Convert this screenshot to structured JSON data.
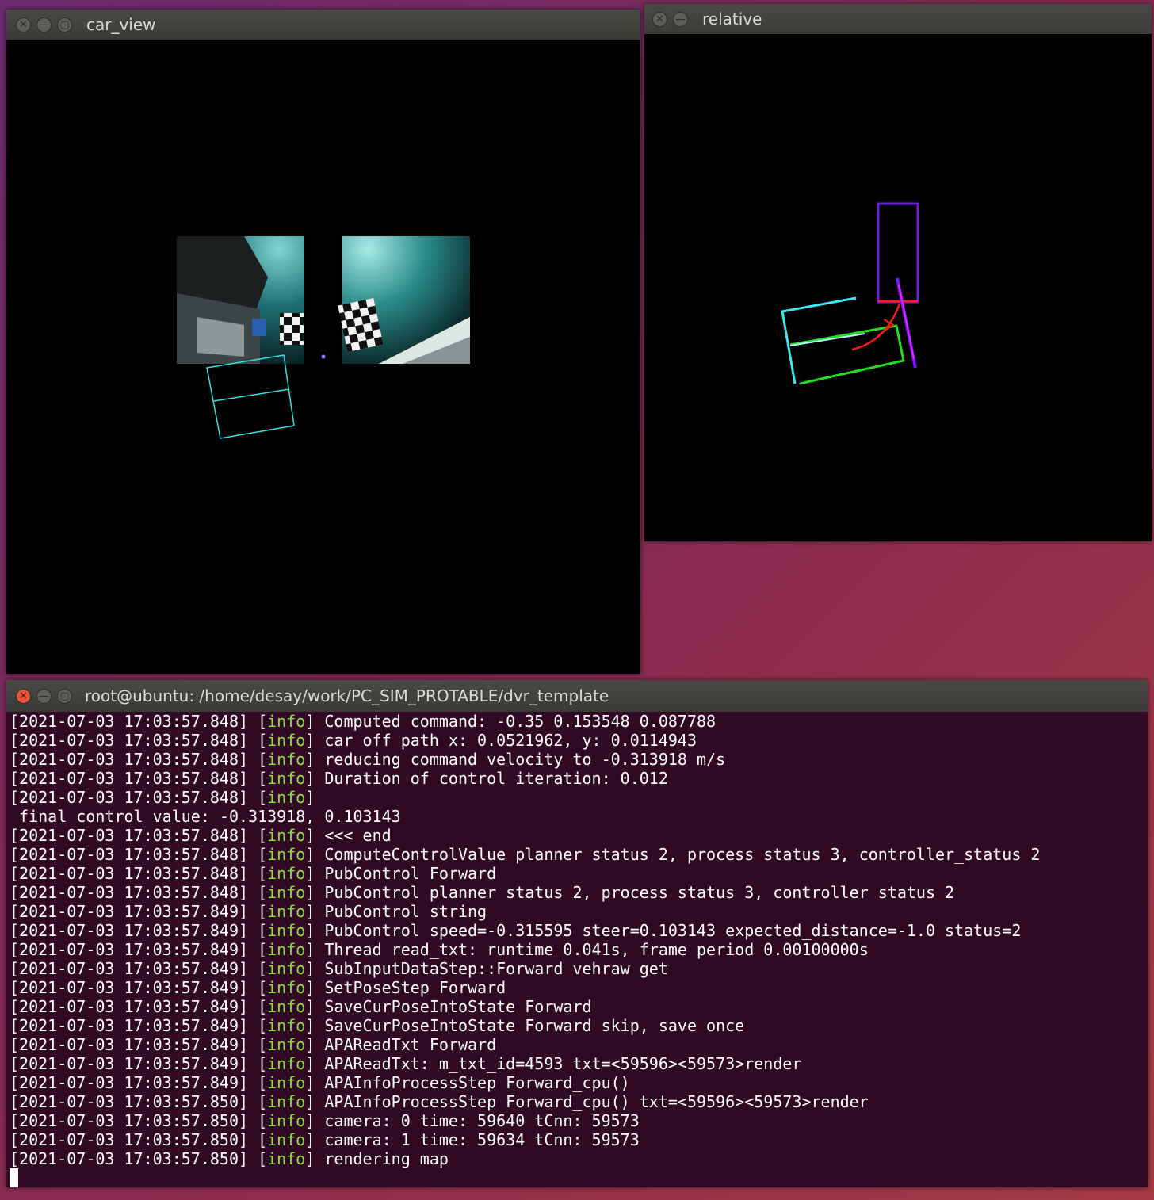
{
  "car_view": {
    "title": "car_view"
  },
  "relative": {
    "title": "relative"
  },
  "terminal": {
    "title": "root@ubuntu: /home/desay/work/PC_SIM_PROTABLE/dvr_template",
    "lines": [
      {
        "ts": "[2021-07-03 17:03:57.848]",
        "lvl": "info",
        "msg": "Computed command: -0.35 0.153548 0.087788"
      },
      {
        "ts": "[2021-07-03 17:03:57.848]",
        "lvl": "info",
        "msg": "car off path x: 0.0521962, y: 0.0114943"
      },
      {
        "ts": "[2021-07-03 17:03:57.848]",
        "lvl": "info",
        "msg": "reducing command velocity to -0.313918 m/s"
      },
      {
        "ts": "[2021-07-03 17:03:57.848]",
        "lvl": "info",
        "msg": "Duration of control iteration: 0.012"
      },
      {
        "ts": "[2021-07-03 17:03:57.848]",
        "lvl": "info",
        "msg": ""
      },
      {
        "raw": " final control value: -0.313918, 0.103143"
      },
      {
        "ts": "[2021-07-03 17:03:57.848]",
        "lvl": "info",
        "msg": "<<< end"
      },
      {
        "ts": "[2021-07-03 17:03:57.848]",
        "lvl": "info",
        "msg": "ComputeControlValue planner status 2, process status 3, controller_status 2"
      },
      {
        "ts": "[2021-07-03 17:03:57.848]",
        "lvl": "info",
        "msg": "PubControl Forward"
      },
      {
        "ts": "[2021-07-03 17:03:57.848]",
        "lvl": "info",
        "msg": "PubControl planner status 2, process status 3, controller status 2"
      },
      {
        "ts": "[2021-07-03 17:03:57.849]",
        "lvl": "info",
        "msg": "PubControl string"
      },
      {
        "ts": "[2021-07-03 17:03:57.849]",
        "lvl": "info",
        "msg": "PubControl speed=-0.315595 steer=0.103143 expected_distance=-1.0 status=2"
      },
      {
        "ts": "[2021-07-03 17:03:57.849]",
        "lvl": "info",
        "msg": "Thread read_txt: runtime 0.041s, frame period 0.00100000s"
      },
      {
        "ts": "[2021-07-03 17:03:57.849]",
        "lvl": "info",
        "msg": "SubInputDataStep::Forward vehraw get"
      },
      {
        "ts": "[2021-07-03 17:03:57.849]",
        "lvl": "info",
        "msg": "SetPoseStep Forward"
      },
      {
        "ts": "[2021-07-03 17:03:57.849]",
        "lvl": "info",
        "msg": "SaveCurPoseIntoState Forward"
      },
      {
        "ts": "[2021-07-03 17:03:57.849]",
        "lvl": "info",
        "msg": "SaveCurPoseIntoState Forward skip, save once"
      },
      {
        "ts": "[2021-07-03 17:03:57.849]",
        "lvl": "info",
        "msg": "APAReadTxt Forward"
      },
      {
        "ts": "[2021-07-03 17:03:57.849]",
        "lvl": "info",
        "msg": "APAReadTxt: m_txt_id=4593 txt=<59596><59573>render"
      },
      {
        "ts": "[2021-07-03 17:03:57.849]",
        "lvl": "info",
        "msg": "APAInfoProcessStep Forward_cpu()"
      },
      {
        "ts": "[2021-07-03 17:03:57.850]",
        "lvl": "info",
        "msg": "APAInfoProcessStep Forward_cpu() txt=<59596><59573>render"
      },
      {
        "ts": "[2021-07-03 17:03:57.850]",
        "lvl": "info",
        "msg": "camera: 0 time: 59640 tCnn: 59573"
      },
      {
        "ts": "[2021-07-03 17:03:57.850]",
        "lvl": "info",
        "msg": "camera: 1 time: 59634 tCnn: 59573"
      },
      {
        "ts": "[2021-07-03 17:03:57.850]",
        "lvl": "info",
        "msg": "rendering map"
      }
    ]
  },
  "colors": {
    "terminal_bg": "#300a24",
    "info": "#8ae234",
    "titlebar": "#3c3b37"
  }
}
